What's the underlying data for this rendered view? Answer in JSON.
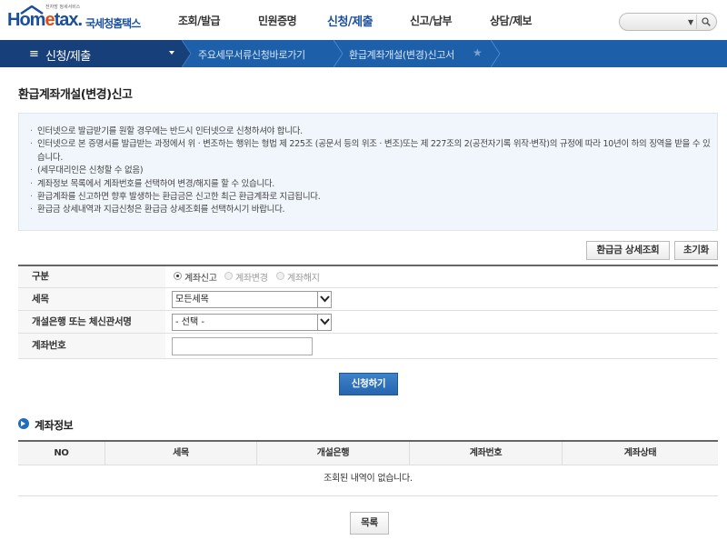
{
  "header": {
    "logo_small": "전자방 정세서비스",
    "logo_brand_pre": "Hom",
    "logo_brand_e": "e",
    "logo_brand_post": "tax.",
    "logo_sub": "국세청홈택스",
    "nav": [
      "조회/발급",
      "민원증명",
      "신청/제출",
      "신고/납부",
      "상담/제보"
    ],
    "active_nav": "신청/제출",
    "search_value": ""
  },
  "navbar": {
    "menu_title": "신청/제출",
    "crumbs": [
      "주요세무서류신청바로가기",
      "환급계좌개설(변경)신고서"
    ]
  },
  "page_title": "환급계좌개설(변경)신고",
  "notices": [
    "인터넷으로 발급받기를 원할 경우에는 반드시 인터넷으로 신청하셔야 합니다.",
    "인터넷으로 본 증명서를 발급받는 과정에서 위 · 변조하는 행위는 형법 제 225조 (공문서 등의 위조 · 변조)또는 제 227조의 2(공전자기록 위작·변작)의 규정에 따라 10년이 하의 징역을 받을 수 있습니다.",
    "(세무대리인은 신청할 수 없음)",
    "계좌정보 목록에서 계좌번호를 선택하여 변경/해지를 할 수 있습니다.",
    "환급계좌를 신고하면 향후 발생하는 환급금은 신고한 최근 환급계좌로 지급됩니다.",
    "환급금 상세내역과 지급신청은 환급금 상세조회를 선택하시기 바랍니다."
  ],
  "buttons": {
    "refund_detail": "환급금 상세조회",
    "reset": "초기화",
    "apply": "신청하기",
    "list": "목록"
  },
  "form": {
    "type_label": "구분",
    "type_options": [
      "계좌신고",
      "계좌변경",
      "계좌해지"
    ],
    "type_selected": "계좌신고",
    "tax_label": "세목",
    "tax_value": "모든세목",
    "bank_label": "개설은행 또는 체신관서명",
    "bank_value": "- 선택 -",
    "account_label": "계좌번호",
    "account_value": ""
  },
  "section_title": "계좌정보",
  "table": {
    "headers": [
      "NO",
      "세목",
      "개설은행",
      "계좌번호",
      "계좌상태"
    ],
    "empty_message": "조회된 내역이 없습니다."
  },
  "colors": {
    "brand_blue": "#1a4f9c",
    "nav_dark": "#173f7a",
    "nav_blue": "#1d5fa8",
    "accent_orange": "#e94b0e",
    "primary_button": "#2566ae"
  }
}
